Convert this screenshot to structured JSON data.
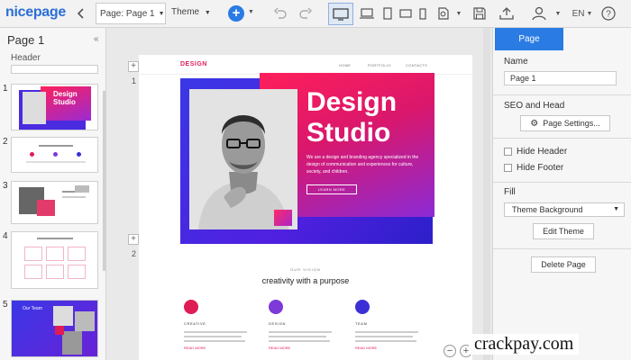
{
  "app": {
    "logo": "nicepage",
    "page_select": "Page: Page 1",
    "theme": "Theme",
    "language": "EN"
  },
  "left_panel": {
    "title": "Page 1",
    "header_label": "Header",
    "thumb_numbers": [
      "1",
      "2",
      "3",
      "4",
      "5"
    ],
    "thumb1_title": "Design Studio",
    "thumb5_title": "Our Team"
  },
  "canvas": {
    "row_numbers": [
      "1",
      "2"
    ],
    "site": {
      "logo": "DESIGN",
      "nav": [
        "HOME",
        "PORTFOLIO",
        "CONTACTS"
      ],
      "hero_title": "Design Studio",
      "hero_text": "We are a design and branding agency specialized in the design of communication and experiences for culture, society, and children.",
      "hero_button": "LEARN MORE",
      "sec2_subtitle": "OUR VISION",
      "sec2_title": "creativity with a purpose",
      "features": [
        {
          "name": "CREATIVE",
          "link": "READ MORE",
          "color": "#e01c57"
        },
        {
          "name": "DESIGN",
          "link": "READ MORE",
          "color": "#7d3ad9"
        },
        {
          "name": "TEAM",
          "link": "READ MORE",
          "color": "#3b2fd6"
        }
      ]
    }
  },
  "right_panel": {
    "tab": "Page",
    "name_label": "Name",
    "name_value": "Page 1",
    "seo_label": "SEO and Head",
    "page_settings_button": "Page Settings...",
    "hide_header": "Hide Header",
    "hide_footer": "Hide Footer",
    "fill_label": "Fill",
    "fill_value": "Theme Background",
    "edit_theme_button": "Edit Theme",
    "delete_page_button": "Delete Page"
  },
  "watermark": "crackpay.com",
  "colors": {
    "accent": "#2a7be4",
    "brand_pink": "#e01c57",
    "brand_blue": "#3a37e6"
  }
}
